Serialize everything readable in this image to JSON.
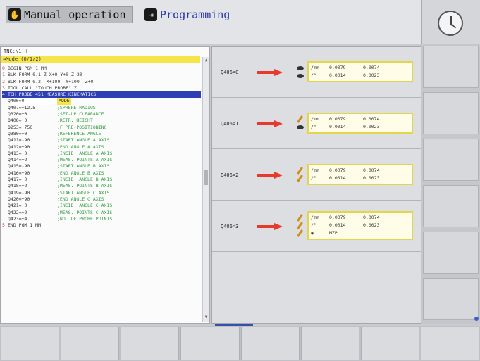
{
  "header": {
    "manual_label": "Manual operation",
    "manual_icon": "hand-wheel-icon",
    "programming_label": "Programming",
    "programming_icon": "programming-icon"
  },
  "program": {
    "file": "TNC:\\1.H",
    "header_line": "→Mode (0/1/2)",
    "lines": [
      {
        "num": "0",
        "code": "BEGIN PGM 1 MM"
      },
      {
        "num": "1",
        "code": "BLK FORM 0.1 Z X+0 Y+0 Z-20"
      },
      {
        "num": "2",
        "code": "BLK FORM 0.2  X+100  Y+100  Z+0"
      },
      {
        "num": "3",
        "code": "TOOL CALL \"TOUCH PROBE\" Z"
      },
      {
        "num": "4",
        "code": "TCH PROBE 451 MEASURE KINEMATICS",
        "selected": true
      },
      {
        "param": "Q406=0",
        "comment": "MODE",
        "active": true
      },
      {
        "param": "Q407=+12.5",
        "comment": ";SPHERE RADIUS"
      },
      {
        "param": "Q320=+0",
        "comment": ";SET-UP CLEARANCE"
      },
      {
        "param": "Q408=+0",
        "comment": ";RETR. HEIGHT"
      },
      {
        "param": "Q253=+750",
        "comment": ";F PRE-POSITIONING"
      },
      {
        "param": "Q380=+0",
        "comment": ";REFERENCE ANGLE"
      },
      {
        "param": "Q411=-90",
        "comment": ";START ANGLE A AXIS"
      },
      {
        "param": "Q412=+90",
        "comment": ";END ANGLE A AXIS"
      },
      {
        "param": "Q413=+0",
        "comment": ";INCID. ANGLE A AXIS"
      },
      {
        "param": "Q414=+2",
        "comment": ";MEAS. POINTS A AXIS"
      },
      {
        "param": "Q415=-90",
        "comment": ";START ANGLE B AXIS"
      },
      {
        "param": "Q416=+90",
        "comment": ";END ANGLE B AXIS"
      },
      {
        "param": "Q417=+0",
        "comment": ";INCID. ANGLE B AXIS"
      },
      {
        "param": "Q418=+2",
        "comment": ";MEAS. POINTS B AXIS"
      },
      {
        "param": "Q419=-90",
        "comment": ";START ANGLE C AXIS"
      },
      {
        "param": "Q420=+90",
        "comment": ";END ANGLE C AXIS"
      },
      {
        "param": "Q421=+0",
        "comment": ";INCID. ANGLE C AXIS"
      },
      {
        "param": "Q422=+2",
        "comment": ";MEAS. POINTS C AXIS"
      },
      {
        "param": "Q423=+4",
        "comment": ";NO. OF PROBE POINTS"
      },
      {
        "num": "5",
        "code": "END PGM 1 MM"
      }
    ]
  },
  "options": [
    {
      "label": "Q406=0",
      "icons": [
        "eye-icon",
        "eye-icon"
      ],
      "rows": [
        [
          "/mm",
          "0.0079",
          "0.0074"
        ],
        [
          "/°",
          "0.0014",
          "0.0023"
        ]
      ]
    },
    {
      "label": "Q406=1",
      "icons": [
        "pencil-icon",
        "eye-icon"
      ],
      "rows": [
        [
          "/mm",
          "0.0079",
          "0.0074"
        ],
        [
          "/°",
          "0.0014",
          "0.0023"
        ]
      ]
    },
    {
      "label": "Q406=2",
      "icons": [
        "pencil-icon",
        "pencil-icon"
      ],
      "rows": [
        [
          "/mm",
          "0.0079",
          "0.0074"
        ],
        [
          "/°",
          "0.0014",
          "0.0023"
        ]
      ]
    },
    {
      "label": "Q406=3",
      "icons": [
        "pencil-icon",
        "pencil-icon",
        "pencil-icon"
      ],
      "rows": [
        [
          "/mm",
          "0.0079",
          "0.0074"
        ],
        [
          "/°",
          "0.0014",
          "0.0023"
        ],
        [
          "◉",
          "MZP",
          ""
        ]
      ]
    }
  ]
}
